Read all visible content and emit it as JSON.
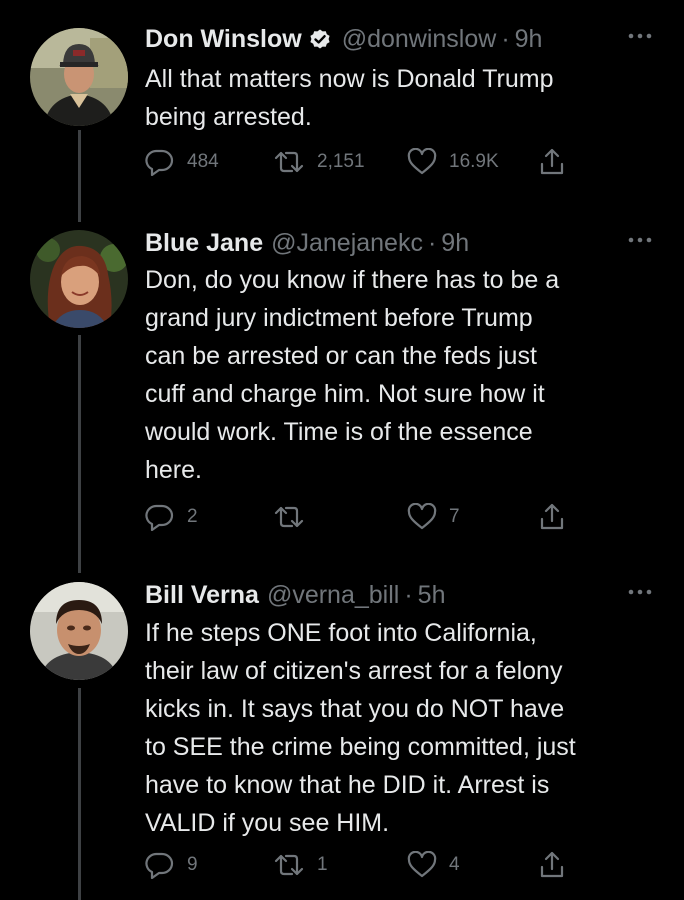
{
  "tweets": [
    {
      "name": "Don Winslow",
      "verified": true,
      "handle": "@donwinslow",
      "time": "9h",
      "text_lines": [
        "All that matters now is Donald Trump",
        "being arrested."
      ],
      "replies": "484",
      "retweets": "2,151",
      "likes": "16.9K"
    },
    {
      "name": "Blue Jane",
      "verified": false,
      "handle": "@Janejanekc",
      "time": "9h",
      "text_lines": [
        "Don, do you know if there has to be a",
        "grand jury indictment before Trump",
        "can be arrested or can the feds just",
        "cuff and charge him. Not sure how it",
        "would work. Time is of the essence",
        "here."
      ],
      "replies": "2",
      "retweets": "",
      "likes": "7"
    },
    {
      "name": "Bill Verna",
      "verified": false,
      "handle": "@verna_bill",
      "time": "5h",
      "text_lines": [
        "If he steps ONE foot into California,",
        "their law of citizen's arrest for a felony",
        "kicks in. It says that you do NOT have",
        "to SEE the crime being committed, just",
        "have to know that he DID it. Arrest is",
        "VALID if you see HIM."
      ],
      "replies": "9",
      "retweets": "1",
      "likes": "4"
    }
  ],
  "separator": "·",
  "colors": {
    "background": "#000000",
    "text": "#e7e9ea",
    "secondary": "#71767b",
    "thread_line": "#3e4144"
  },
  "icons": {
    "verified": "verified-badge-icon",
    "more": "more-dots-icon",
    "reply": "reply-icon",
    "retweet": "retweet-icon",
    "like": "heart-icon",
    "share": "share-icon"
  }
}
